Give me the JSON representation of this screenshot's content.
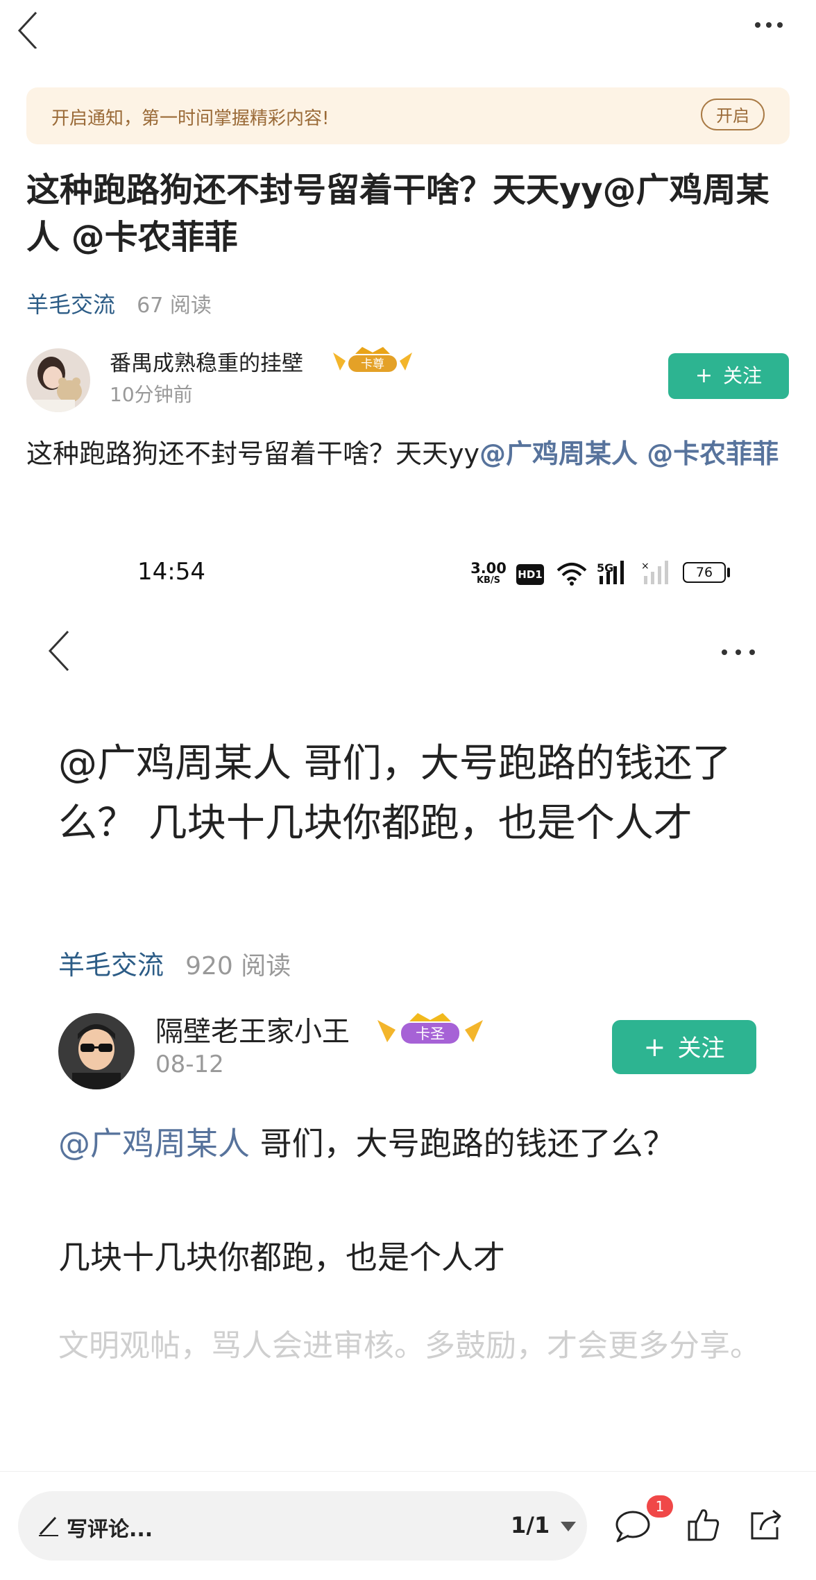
{
  "notice": {
    "text": "开启通知，第一时间掌握精彩内容!",
    "button": "开启"
  },
  "post": {
    "title": "这种跑路狗还不封号留着干啥？天天yy@广鸡周某人 @卡农菲菲",
    "category": "羊毛交流",
    "reads": "67 阅读",
    "author": "番禺成熟稳重的挂壁",
    "badge": "卡尊",
    "time": "10分钟前",
    "follow": "关注",
    "body_plain": "这种跑路狗还不封号留着干啥？天天yy",
    "body_mention": "@广鸡周某人 @卡农菲菲"
  },
  "screenshot": {
    "status_time": "14:54",
    "net_speed_top": "3.00",
    "net_speed_bottom": "KB/S",
    "hd": "HD1",
    "signal_5g": "5G",
    "battery": "76",
    "title": "@广鸡周某人 哥们，大号跑路的钱还了么？ 几块十几块你都跑，也是个人才",
    "category": "羊毛交流",
    "reads": "920 阅读",
    "author": "隔壁老王家小王",
    "badge": "卡圣",
    "time": "08-12",
    "follow": "关注",
    "body_mention": "@广鸡周某人",
    "body_line1": " 哥们，大号跑路的钱还了么？",
    "body_line2": "几块十几块你都跑，也是个人才",
    "placeholder": "文明观帖，骂人会进审核。多鼓励，才会更多分享。"
  },
  "bottom": {
    "comment_placeholder": "写评论...",
    "page": "1/1",
    "comment_count": "1"
  }
}
